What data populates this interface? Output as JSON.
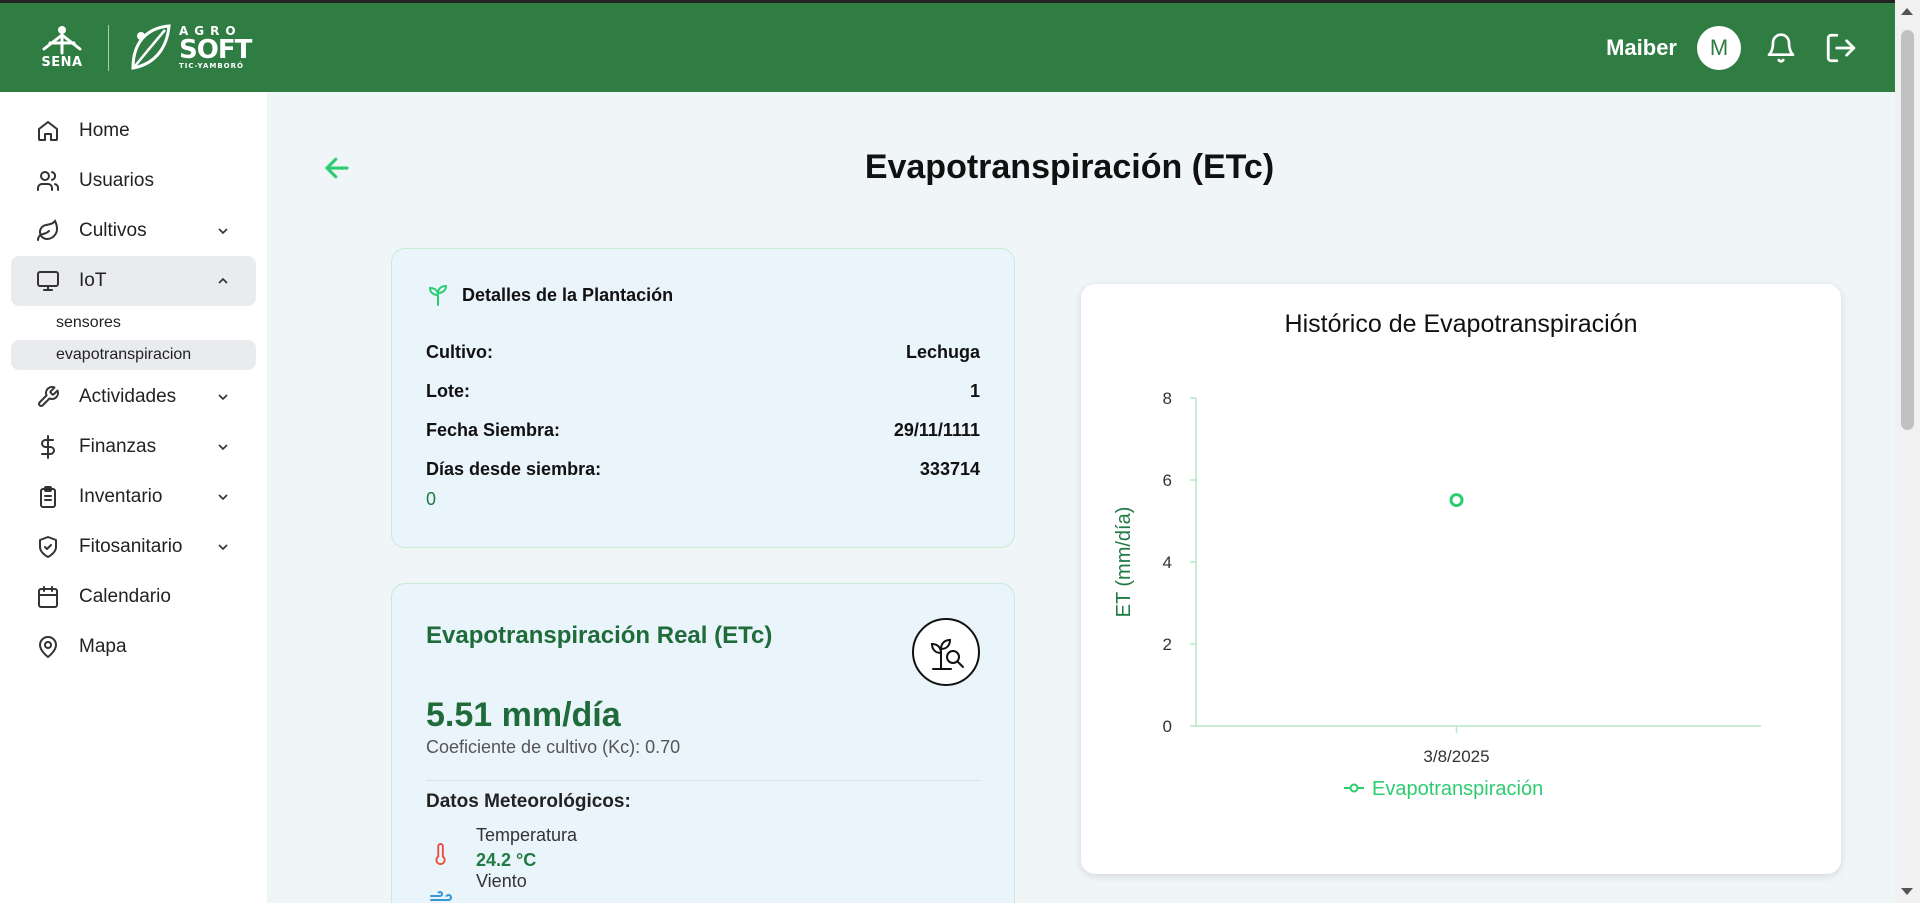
{
  "header": {
    "sena_label": "SENA",
    "agro_top": "AGRO",
    "agro_mid": "SOFT",
    "agro_bot": "TIC-YAMBORÓ",
    "user_name": "Maiber",
    "avatar_letter": "M"
  },
  "sidebar": {
    "items": [
      {
        "label": "Home",
        "icon": "home-icon"
      },
      {
        "label": "Usuarios",
        "icon": "users-icon"
      },
      {
        "label": "Cultivos",
        "icon": "leaf-icon"
      },
      {
        "label": "IoT",
        "icon": "monitor-icon"
      },
      {
        "label": "Actividades",
        "icon": "wrench-icon"
      },
      {
        "label": "Finanzas",
        "icon": "dollar-icon"
      },
      {
        "label": "Inventario",
        "icon": "clipboard-icon"
      },
      {
        "label": "Fitosanitario",
        "icon": "shield-icon"
      },
      {
        "label": "Calendario",
        "icon": "calendar-icon"
      },
      {
        "label": "Mapa",
        "icon": "map-pin-icon"
      }
    ],
    "iot_sub": [
      "sensores",
      "evapotranspiracion"
    ]
  },
  "page": {
    "title": "Evapotranspiración (ETc)"
  },
  "details": {
    "title": "Detalles de la Plantación",
    "rows": [
      {
        "label": "Cultivo:",
        "value": "Lechuga"
      },
      {
        "label": "Lote:",
        "value": "1"
      },
      {
        "label": "Fecha Siembra:",
        "value": "29/11/1111"
      },
      {
        "label": "Días desde siembra:",
        "value": "333714"
      }
    ],
    "extra": "0"
  },
  "etc": {
    "title": "Evapotranspiración Real (ETc)",
    "value": "5.51 mm/día",
    "kc": "Coeficiente de cultivo (Kc): 0.70",
    "meteo_title": "Datos Meteorológicos:",
    "meteo": [
      {
        "label": "Temperatura",
        "value": "24.2 °C",
        "icon": "thermometer-icon"
      },
      {
        "label": "Viento",
        "value": "",
        "icon": "wind-icon"
      }
    ]
  },
  "colors": {
    "header_green": "#2f7d43",
    "accent_green": "#2ecc71",
    "dark_green": "#1f6b3a"
  },
  "chart_data": {
    "type": "line",
    "title": "Histórico de Evapotranspiración",
    "ylabel": "ET (mm/día)",
    "xlabel": "",
    "categories": [
      "3/8/2025"
    ],
    "series": [
      {
        "name": "Evapotranspiración",
        "values": [
          5.51
        ]
      }
    ],
    "ylim": [
      0,
      8
    ],
    "yticks": [
      0,
      2,
      4,
      6,
      8
    ],
    "legend": "bottom",
    "grid": false
  }
}
